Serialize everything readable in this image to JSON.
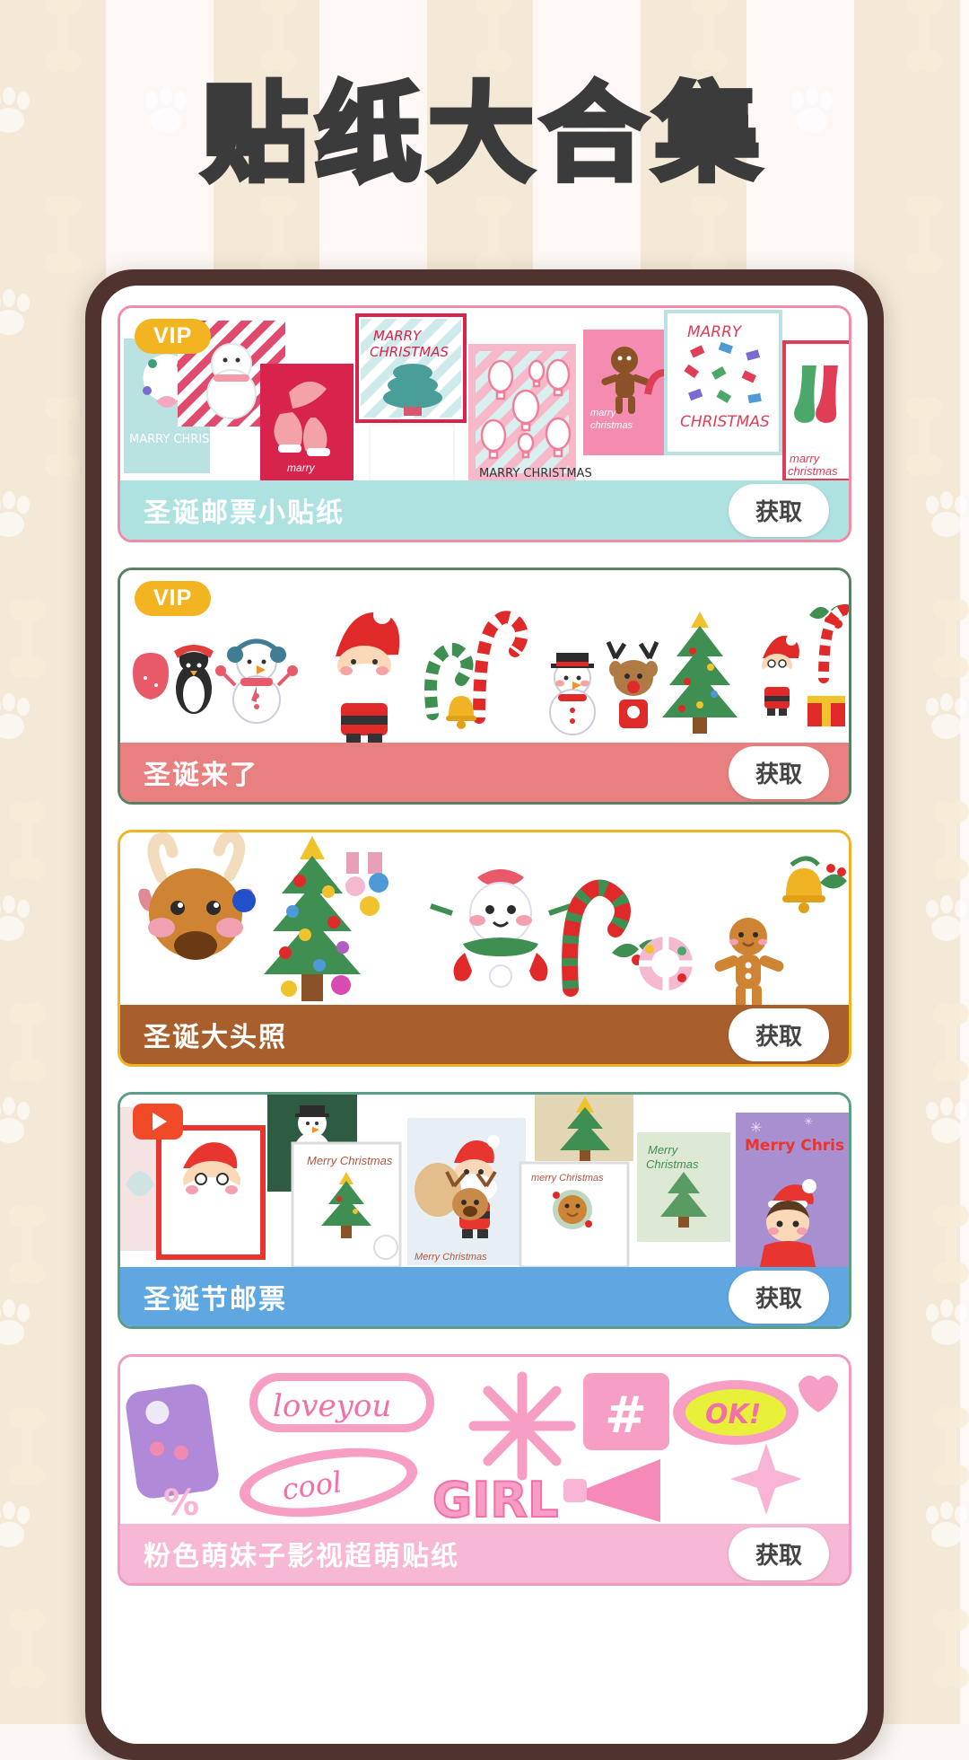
{
  "page": {
    "title": "贴纸大合集",
    "background": {
      "stripe_light": "#fdf8f6",
      "stripe_beige": "#f3e9d6"
    },
    "title_color": "#3b3b3b"
  },
  "phone": {
    "frame_color": "#50322f",
    "screen_color": "#ffffff"
  },
  "badges": {
    "vip_label": "VIP",
    "vip_color": "#f3b421",
    "play_icon": "play-icon",
    "play_color": "#f04a28"
  },
  "common": {
    "get_label": "获取"
  },
  "cards": [
    {
      "id": "christmas-stamps-small",
      "name": "圣诞邮票小贴纸",
      "get_label": "获取",
      "badge": "VIP",
      "border_color": "#f28ba6",
      "bar_color": "#aee2e0",
      "text_color": "#ffffff",
      "art_caption": "MARRY CHRISTMAS"
    },
    {
      "id": "christmas-is-coming",
      "name": "圣诞来了",
      "get_label": "获取",
      "badge": "VIP",
      "border_color": "#5b7f63",
      "bar_color": "#e98080",
      "text_color": "#ffffff",
      "art_caption": ""
    },
    {
      "id": "christmas-big-head",
      "name": "圣诞大头照",
      "get_label": "获取",
      "badge": "",
      "border_color": "#f0b321",
      "bar_color": "#a85f2c",
      "text_color": "#ffffff",
      "art_caption": ""
    },
    {
      "id": "christmas-postage",
      "name": "圣诞节邮票",
      "get_label": "获取",
      "badge": "play-icon",
      "border_color": "#5a9e86",
      "bar_color": "#5fa7e0",
      "text_color": "#ffffff",
      "art_caption": "Merry Christmas"
    },
    {
      "id": "girly-stickers",
      "name": "粉色萌妹子影视超萌贴纸",
      "get_label": "获取",
      "badge": "",
      "border_color": "#f29ac4",
      "bar_color": "#f6b8d4",
      "text_color": "#ffffff",
      "art_caption": "loveyou"
    }
  ],
  "card5_art_text": {
    "loveyou": "loveyou",
    "cool": "cool",
    "girl": "GIRL",
    "ok": "OK!",
    "hash": "#",
    "percent": "%"
  }
}
